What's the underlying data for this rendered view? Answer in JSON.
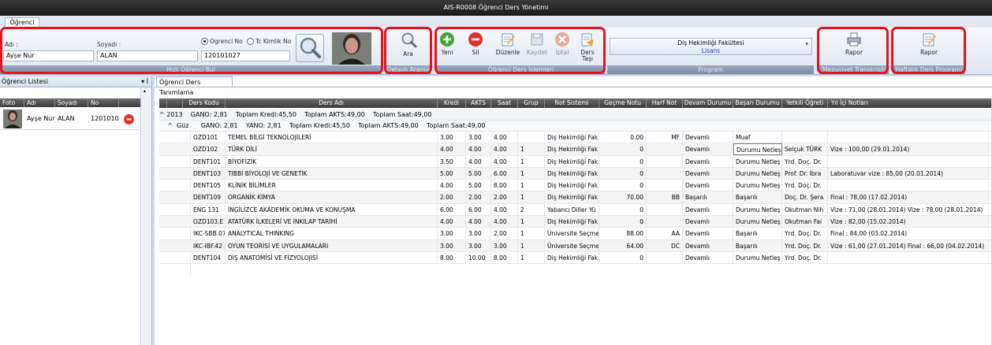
{
  "window": {
    "title": "AIS-R0008 Öğrenci Ders Yönetimi"
  },
  "ribbon": {
    "tab": "Öğrenci",
    "quick_find": {
      "name_label": "Adı :",
      "surname_label": "Soyadı :",
      "name_value": "Ayşe Nur",
      "surname_value": "ALAN",
      "radio_student_no": "Ogrenci No",
      "radio_tc": "Tc Kimlik No",
      "number_value": "120101027",
      "group_label": "Hızlı Öğrenci Bul"
    },
    "detailed_search": {
      "button": "Ara",
      "group_label": "Detaylı Arama"
    },
    "course_ops": {
      "new": "Yeni",
      "delete": "Sil",
      "edit": "Düzenle",
      "save": "Kaydet",
      "cancel": "İptal",
      "move_line1": "Ders",
      "move_line2": "Taşı",
      "group_label": "Öğrenci Ders İşlemleri"
    },
    "program": {
      "faculty": "Diş Hekimliği Fakültesi",
      "level": "Lisans",
      "group_label": "Program"
    },
    "graduation": {
      "button": "Rapor",
      "group_label": "Mezuniyet Transkripti"
    },
    "weekly": {
      "button": "Rapor",
      "group_label": "Haftalık Ders Programı"
    }
  },
  "left_panel": {
    "title": "Öğrenci Listesi",
    "pin": "▾ ꟾ",
    "columns": [
      "Foto",
      "Adı",
      "Soyadı",
      "No"
    ],
    "student": {
      "name": "Ayşe Nur",
      "surname": "ALAN",
      "no": "1201010"
    }
  },
  "right_panel": {
    "tab": "Öğrenci Ders Tanımlama",
    "columns": [
      "Ders Kodu",
      "Ders Adı",
      "Kredi",
      "AKTS",
      "Saat",
      "Grup",
      "Not Sistemi",
      "Geçme Notu",
      "Harf Not",
      "Devam Durumu",
      "Başarı Durumu",
      "Yetkili Öğreti",
      "Yıl İçi Notları"
    ],
    "group_year": "^ 2013    GANO: 2,81    Toplam Kredi:45,50    Toplam AKTS:49,00    Toplam Saat:49,00",
    "group_term": "    ^  Güz      GANO: 2,81    YANO: 2,81    Toplam Kredi:45,50    Toplam AKTS:49,00    Toplam Saat:49,00",
    "rows": [
      [
        "OZD101",
        "TEMEL BİLGİ TEKNOLOJİLERİ",
        "3.00",
        "3.00",
        "4.00",
        "",
        "Diş Hekimliği Fak",
        "0.00",
        "MF",
        "Devamlı",
        "Muaf",
        "",
        ""
      ],
      [
        "OZD102",
        "TÜRK DİLİ",
        "4.00",
        "4.00",
        "4.00",
        "1",
        "Diş Hekimliği Fak",
        "0",
        "",
        "Devamlı",
        "Durumu Netleş",
        "Selçuk TÜRK",
        "Vize : 100,00 (29.01.2014)"
      ],
      [
        "DENT101",
        "BİYOFİZİK",
        "3.50",
        "4.00",
        "4.00",
        "1",
        "Diş Hekimliği Fak",
        "0",
        "",
        "Devamlı",
        "Durumu Netleş",
        "Yrd. Doç. Dr.",
        ""
      ],
      [
        "DENT103",
        "TIBBİ BİYOLOJİ VE GENETİK",
        "5.00",
        "5.00",
        "6.00",
        "1",
        "Diş Hekimliği Fak",
        "0",
        "",
        "Devamlı",
        "Durumu Netleş",
        "Prof. Dr. İbra",
        "Laboratuvar vize : 85,00 (20.01.2014)"
      ],
      [
        "DENT105",
        "KLİNİK BİLİMLER",
        "4.00",
        "5.00",
        "8.00",
        "1",
        "Diş Hekimliği Fak",
        "0",
        "",
        "Devamlı",
        "Durumu Netleş",
        "Yrd. Doç. Dr.",
        ""
      ],
      [
        "DENT109",
        "ORGANİK KİMYA",
        "2.00",
        "2.00",
        "2.00",
        "1",
        "Diş Hekimliği Fak",
        "70.00",
        "BB",
        "Başarılı",
        "Başarılı",
        "Doç. Dr. Şera",
        "Final : 78,00 (17.02.2014)"
      ],
      [
        "ENG 131",
        "İNGİLİZCE AKADEMİK OKUMA VE KONUŞMA",
        "6.00",
        "6.00",
        "4.00",
        "2",
        "Yabancı Diller Yü",
        "0",
        "",
        "Devamlı",
        "Durumu Netleş",
        "Okutman Nih",
        "Vize : 71,00 (28.01.2014) Vize : 78,00 (28.01.2014)"
      ],
      [
        "OZD103.E",
        "ATATÜRK İLKELERİ VE İNKILAP TARİHİ",
        "4.00",
        "4.00",
        "4.00",
        "1",
        "Diş Hekimliği Fak",
        "0",
        "",
        "Devamlı",
        "Durumu Netleş",
        "Okutman Fai",
        "Vize : 82,00 (15.02.2014)"
      ],
      [
        "IKC-SBB.07",
        "ANALYTICAL THINKING",
        "3.00",
        "3.00",
        "2.00",
        "1",
        "Üniversite Seçme",
        "88.00",
        "AA",
        "Devamlı",
        "Başarılı",
        "Yrd. Doç. Dr.",
        "Final : 84,00 (03.02.2014)"
      ],
      [
        "IKC-IBF.42",
        "OYUN TEORİSİ VE UYGULAMALARI",
        "3.00",
        "3.00",
        "3.00",
        "1",
        "Üniversite Seçme",
        "64.00",
        "DC",
        "Devamlı",
        "Başarılı",
        "Yrd. Doç. Dr.",
        "Vize : 61,00 (27.01.2014) Final : 66,00 (04.02.2014)"
      ],
      [
        "DENT104",
        "DİŞ ANATOMİSİ VE FİZYOLOJİSİ",
        "8.00",
        "10.00",
        "8.00",
        "1",
        "Diş Hekimliği Fak",
        "0",
        "",
        "Devamlı",
        "Durumu Netleş",
        "Yrd. Doç. Dr.",
        ""
      ]
    ]
  },
  "colors": {
    "highlight_box": "#e8101a",
    "header_dark": "#3c3c3c",
    "group_bar": "#7d8ca5"
  }
}
